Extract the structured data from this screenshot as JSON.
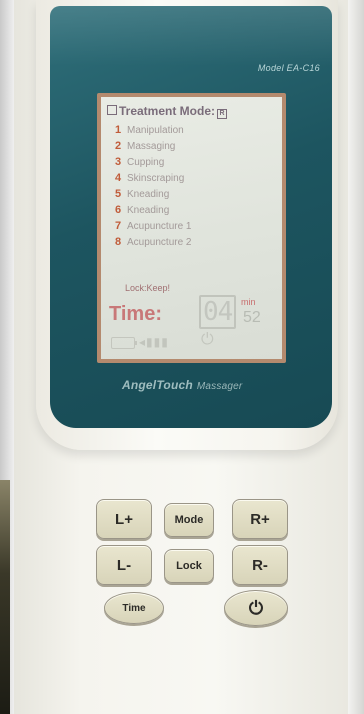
{
  "device": {
    "model": "Model EA-C16",
    "brand": "AngelTouch",
    "brand_suffix": "Massager"
  },
  "screen": {
    "title": "Treatment Mode",
    "modes": [
      {
        "number": "1",
        "label": "Manipulation"
      },
      {
        "number": "2",
        "label": "Massaging"
      },
      {
        "number": "3",
        "label": "Cupping"
      },
      {
        "number": "4",
        "label": "Skinscraping"
      },
      {
        "number": "5",
        "label": "Kneading"
      },
      {
        "number": "6",
        "label": "Kneading"
      },
      {
        "number": "7",
        "label": "Acupuncture 1"
      },
      {
        "number": "8",
        "label": "Acupuncture 2"
      }
    ],
    "lock_label": "Lock:",
    "lock_value": "Keep!",
    "time_label": "Time:",
    "minutes": "04",
    "minutes_unit": "min",
    "seconds": "52"
  },
  "buttons": {
    "l_plus": "L+",
    "mode": "Mode",
    "r_plus": "R+",
    "l_minus": "L-",
    "lock": "Lock",
    "r_minus": "R-",
    "time": "Time",
    "power_icon": "power-icon"
  },
  "colors": {
    "bezel": "#1d5560",
    "screen": "#dfe3db",
    "button": "#e2dec4",
    "accent_number": "#c05c3a",
    "time_label": "#c87878"
  }
}
